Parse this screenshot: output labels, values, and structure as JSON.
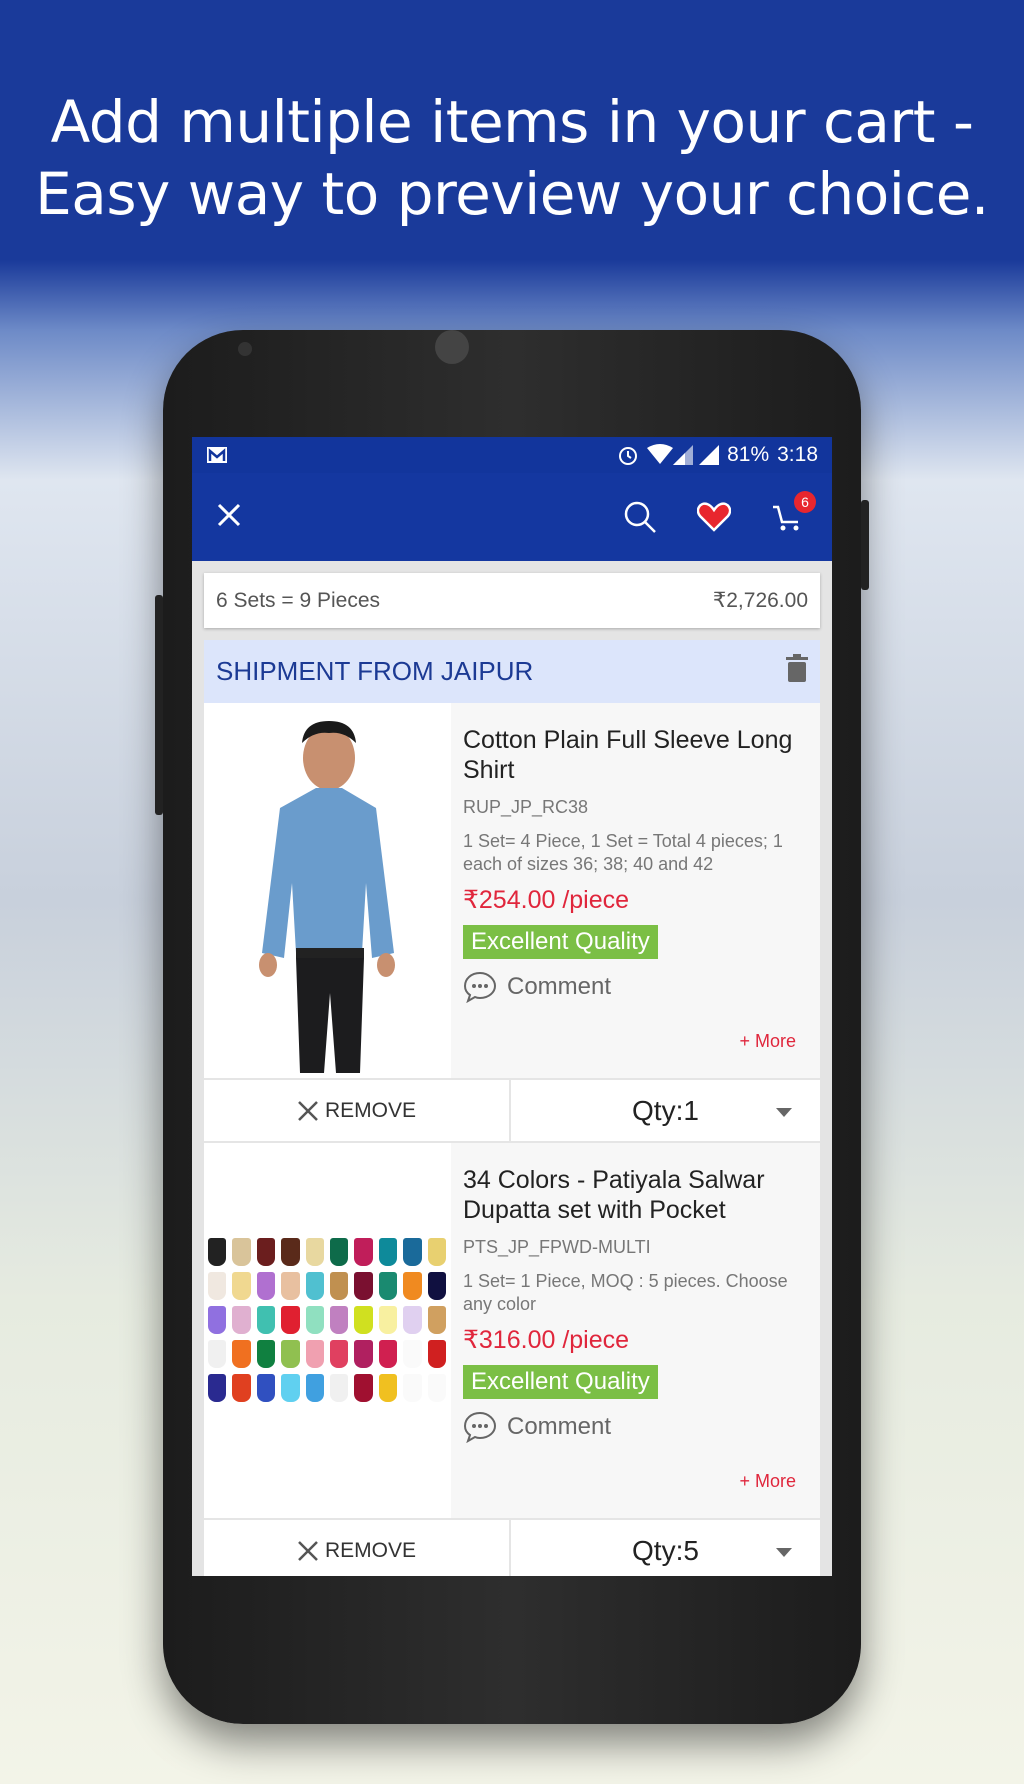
{
  "headline": {
    "line1": "Add multiple items in your cart -",
    "line2": "Easy way to preview your choice."
  },
  "status_bar": {
    "left_icon": "gmail-icon",
    "icons": [
      "alarm-icon",
      "wifi-icon",
      "signal-icon",
      "signal-icon"
    ],
    "battery": "81%",
    "time": "3:18"
  },
  "toolbar": {
    "close_icon": "close-icon",
    "search_icon": "search-icon",
    "wishlist_icon": "heart-icon",
    "cart_icon": "cart-icon",
    "cart_count": "6",
    "color": "#1437a0"
  },
  "summary": {
    "sets": "6 Sets = 9 Pieces",
    "total": "₹2,726.00"
  },
  "shipment": {
    "title": "SHIPMENT FROM JAIPUR",
    "delete_icon": "trash-icon"
  },
  "items": [
    {
      "title": "Cotton Plain Full Sleeve Long Shirt",
      "code": "RUP_JP_RC38",
      "desc": "1 Set= 4 Piece, 1 Set = Total 4 pieces; 1 each of sizes 36; 38; 40 and 42",
      "price": "₹254.00 /piece",
      "quality": "Excellent Quality",
      "comment": "Comment",
      "more": "+ More",
      "remove": "REMOVE",
      "qty": "Qty:1"
    },
    {
      "title": "34 Colors - Patiyala Salwar Dupatta set with Pocket",
      "code": "PTS_JP_FPWD-MULTI",
      "desc": "1 Set= 1 Piece, MOQ : 5 pieces. Choose any color",
      "price": "₹316.00 /piece",
      "quality": "Excellent Quality",
      "comment": "Comment",
      "more": "+ More",
      "remove": "REMOVE",
      "qty": "Qty:5"
    }
  ],
  "colors": {
    "price": "#e0263c",
    "quality_badge": "#7bbf45",
    "shipment_bg": "#dce5fb"
  }
}
